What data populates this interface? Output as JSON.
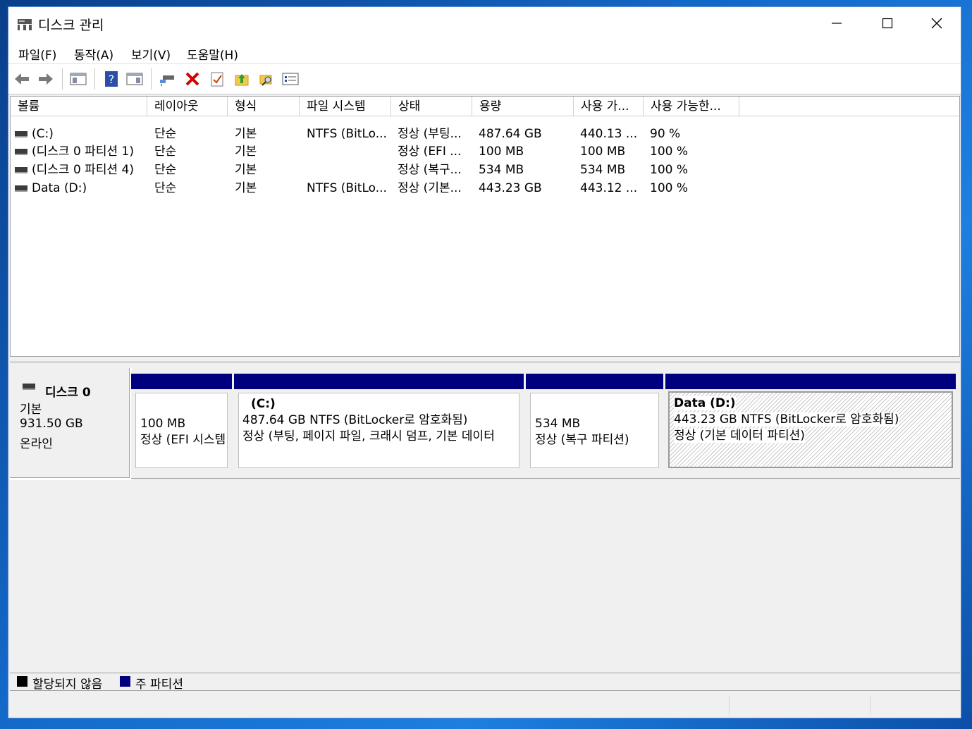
{
  "window": {
    "title": "디스크 관리"
  },
  "menu": [
    {
      "label": "파일(F)"
    },
    {
      "label": "동작(A)"
    },
    {
      "label": "보기(V)"
    },
    {
      "label": "도움말(H)"
    }
  ],
  "toolbar": {
    "icons": [
      "back-arrow-icon",
      "forward-arrow-icon",
      "console-tree-icon",
      "help-icon",
      "action-pane-icon",
      "connect-drive-icon",
      "delete-icon",
      "properties-icon",
      "up-folder-icon",
      "search-folder-icon",
      "settings-list-icon"
    ]
  },
  "columns": [
    "볼륨",
    "레이아웃",
    "형식",
    "파일 시스템",
    "상태",
    "용량",
    "사용 가...",
    "사용 가능한..."
  ],
  "volumes": [
    {
      "name": " (C:)",
      "layout": "단순",
      "type": "기본",
      "fs": "NTFS (BitLo...",
      "status": "정상 (부팅...",
      "capacity": "487.64 GB",
      "free": "440.13 ...",
      "pct": "90 %"
    },
    {
      "name": "(디스크 0 파티션 1)",
      "layout": "단순",
      "type": "기본",
      "fs": "",
      "status": "정상 (EFI ...",
      "capacity": "100 MB",
      "free": "100 MB",
      "pct": "100 %"
    },
    {
      "name": "(디스크 0 파티션 4)",
      "layout": "단순",
      "type": "기본",
      "fs": "",
      "status": "정상 (복구...",
      "capacity": "534 MB",
      "free": "534 MB",
      "pct": "100 %"
    },
    {
      "name": "Data (D:)",
      "layout": "단순",
      "type": "기본",
      "fs": "NTFS (BitLo...",
      "status": "정상 (기본...",
      "capacity": "443.23 GB",
      "free": "443.12 ...",
      "pct": "100 %"
    }
  ],
  "disk": {
    "name": "디스크 0",
    "type": "기본",
    "size": "931.50 GB",
    "state": "온라인",
    "partitions": [
      {
        "title": "",
        "line1": "100 MB",
        "line2": "정상 (EFI 시스템"
      },
      {
        "title": "(C:)",
        "line1": "487.64 GB NTFS (BitLocker로 암호화됨)",
        "line2": "정상 (부팅, 페이지 파일, 크래시 덤프, 기본 데이터"
      },
      {
        "title": "",
        "line1": "534 MB",
        "line2": "정상 (복구 파티션)"
      },
      {
        "title": "Data  (D:)",
        "line1": "443.23 GB NTFS (BitLocker로 암호화됨)",
        "line2": "정상 (기본 데이터 파티션)"
      }
    ]
  },
  "legend": [
    {
      "label": "할당되지 않음",
      "color": "#000000"
    },
    {
      "label": "주 파티션",
      "color": "#00007f"
    }
  ]
}
